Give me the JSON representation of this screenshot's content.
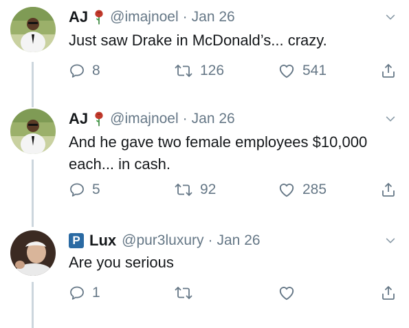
{
  "tweets": [
    {
      "name": "AJ",
      "handle": "@imajnoel",
      "separator": "·",
      "date": "Jan 26",
      "text": "Just saw Drake in McDonald’s... crazy.",
      "replies": "8",
      "retweets": "126",
      "likes": "541"
    },
    {
      "name": "AJ",
      "handle": "@imajnoel",
      "separator": "·",
      "date": "Jan 26",
      "text": "And he gave two female employees $10,000 each... in cash.",
      "replies": "5",
      "retweets": "92",
      "likes": "285"
    },
    {
      "name": "Lux",
      "badge": "P",
      "handle": "@pur3luxury",
      "separator": "·",
      "date": "Jan 26",
      "text": "Are you serious",
      "replies": "1",
      "retweets": "",
      "likes": ""
    }
  ],
  "colors": {
    "text": "#14171a",
    "muted": "#657786",
    "thread_line": "#ccd6dd",
    "rose": "#c0392b",
    "badge": "#2a6aa3"
  },
  "icons": [
    "rose-emoji-icon",
    "chevron-down-icon",
    "reply-icon",
    "retweet-icon",
    "like-icon",
    "share-icon"
  ]
}
